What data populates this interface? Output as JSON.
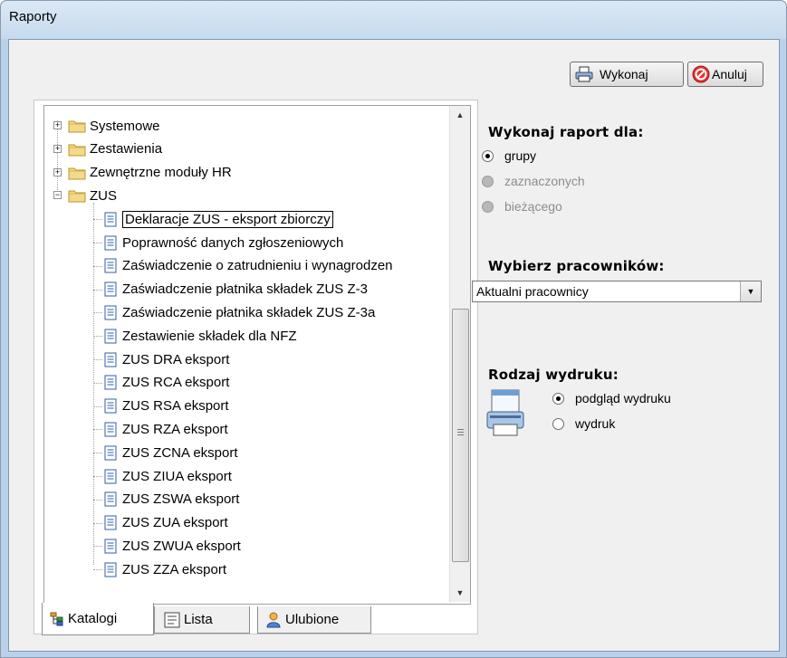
{
  "window": {
    "title": "Raporty"
  },
  "toolbar": {
    "execute_label": "Wykonaj",
    "cancel_label": "Anuluj"
  },
  "tree": {
    "folders": [
      {
        "label": "Systemowe",
        "expanded": false
      },
      {
        "label": "Zestawienia",
        "expanded": false
      },
      {
        "label": "Zewnętrzne moduły HR",
        "expanded": false
      },
      {
        "label": "ZUS",
        "expanded": true
      }
    ],
    "items": [
      "Deklaracje ZUS - eksport zbiorczy",
      "Poprawność danych zgłoszeniowych",
      "Zaświadczenie o zatrudnieniu i wynagrodzen",
      "Zaświadczenie płatnika składek ZUS Z-3",
      "Zaświadczenie płatnika składek ZUS Z-3a",
      "Zestawienie składek dla NFZ",
      "ZUS DRA eksport",
      "ZUS RCA eksport",
      "ZUS RSA eksport",
      "ZUS RZA eksport",
      "ZUS ZCNA eksport",
      "ZUS ZIUA eksport",
      "ZUS ZSWA eksport",
      "ZUS ZUA eksport",
      "ZUS ZWUA eksport",
      "ZUS ZZA eksport"
    ],
    "selected_index": 0
  },
  "tabs": [
    {
      "label": "Katalogi",
      "icon": "tree-catalog-icon",
      "active": true
    },
    {
      "label": "Lista",
      "icon": "list-icon",
      "active": false
    },
    {
      "label": "Ulubione",
      "icon": "favorites-user-icon",
      "active": false
    }
  ],
  "report_for": {
    "heading": "Wykonaj raport dla:",
    "options": [
      {
        "label": "grupy",
        "checked": true,
        "enabled": true
      },
      {
        "label": "zaznaczonych",
        "checked": false,
        "enabled": false
      },
      {
        "label": "bieżącego",
        "checked": false,
        "enabled": false
      }
    ]
  },
  "employees": {
    "heading": "Wybierz pracowników:",
    "selected": "Aktualni pracownicy"
  },
  "print_type": {
    "heading": "Rodzaj wydruku:",
    "options": [
      {
        "label": "podgląd wydruku",
        "checked": true
      },
      {
        "label": "wydruk",
        "checked": false
      }
    ]
  },
  "colors": {
    "window_frame": "#b9d1ea",
    "client_bg": "#f0f0f0",
    "folder": "#e8c66a",
    "doc_blue": "#2f5fa8"
  }
}
